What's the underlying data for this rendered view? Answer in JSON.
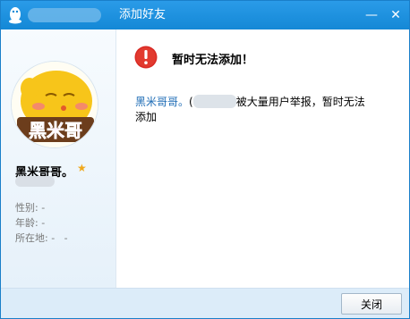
{
  "window": {
    "title": "添加好友",
    "minimize_label": "—",
    "close_label": "✕"
  },
  "profile": {
    "avatar_text": "黑米哥",
    "nickname": "黑米哥哥。",
    "star_icon": "★",
    "fields": [
      {
        "label": "性别:",
        "value": "-"
      },
      {
        "label": "年龄:",
        "value": "-"
      },
      {
        "label": "所在地:",
        "value": "-   -"
      }
    ]
  },
  "message": {
    "title": "暂时无法添加！",
    "nick": "黑米哥哥。",
    "open_paren": "(",
    "text_after": "被大量用户举报，暂时无法添加"
  },
  "footer": {
    "close_button": "关闭"
  },
  "colors": {
    "titlebar": "#1488d6",
    "error_red": "#d92a25",
    "link_blue": "#1c6bb5"
  }
}
